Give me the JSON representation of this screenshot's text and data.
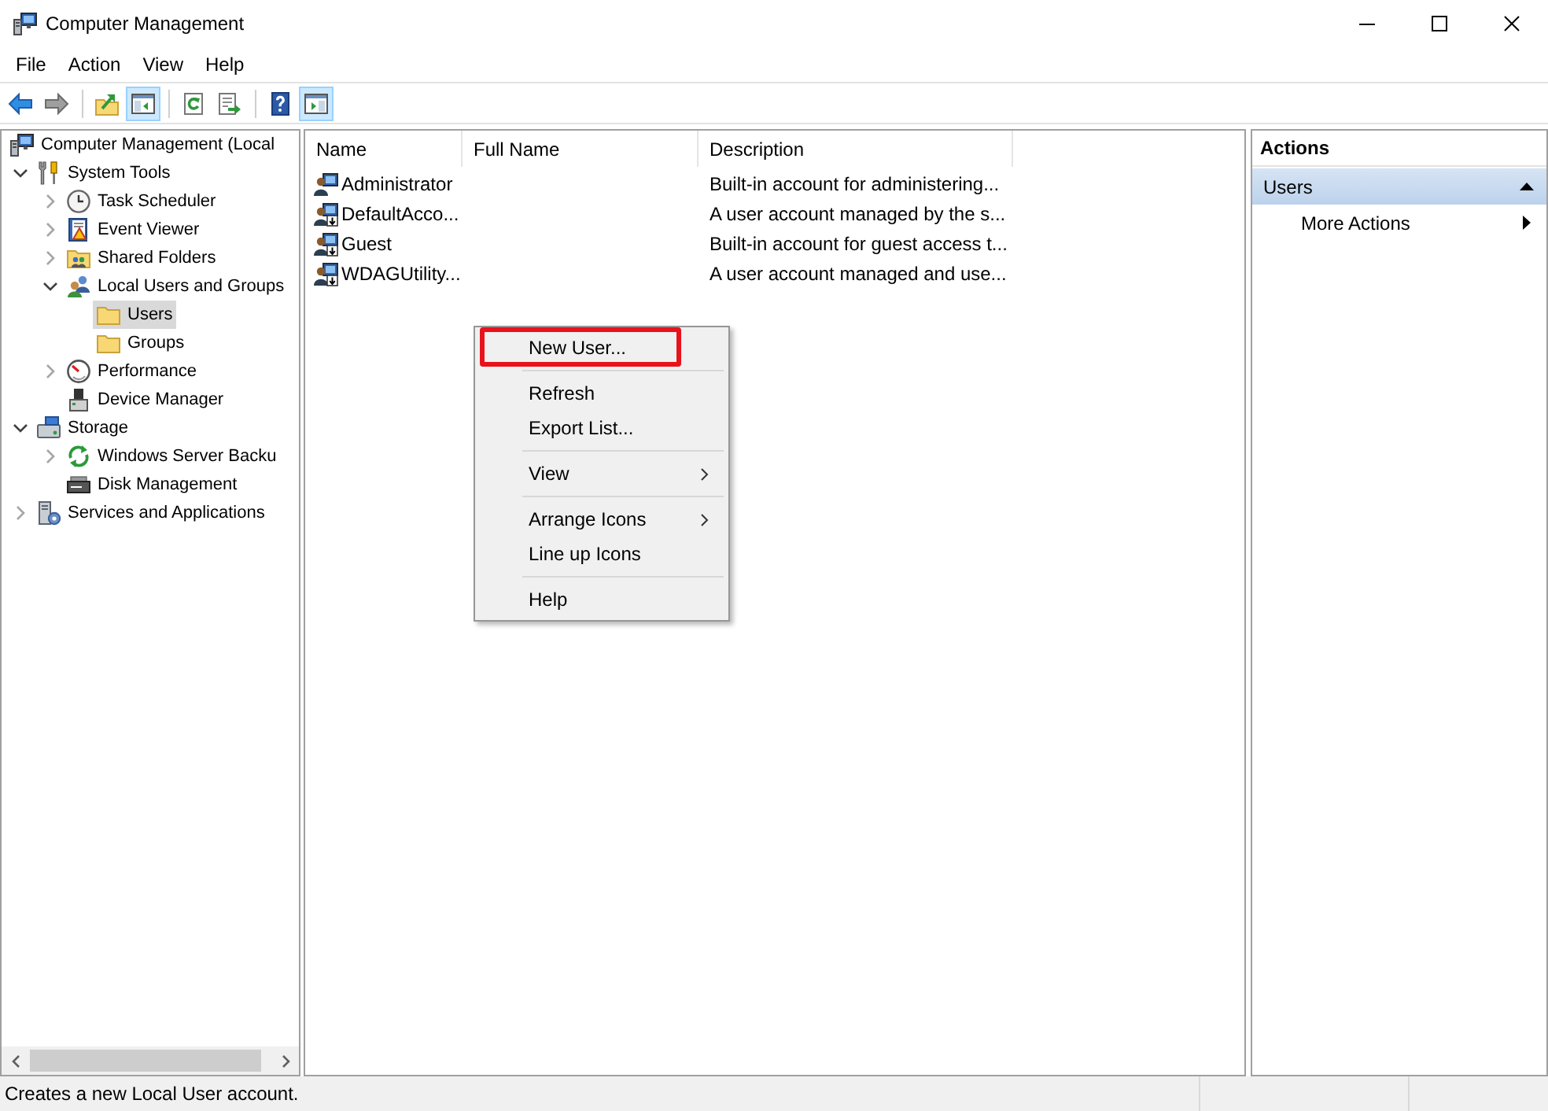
{
  "window": {
    "title": "Computer Management"
  },
  "menu_bar": [
    "File",
    "Action",
    "View",
    "Help"
  ],
  "toolbar": [
    {
      "buttons": [
        {
          "kind": "back",
          "on": false,
          "disabled": false
        },
        {
          "kind": "forward",
          "on": false,
          "disabled": true
        }
      ]
    },
    {
      "buttons": [
        {
          "kind": "up",
          "on": false,
          "disabled": false
        },
        {
          "kind": "console_tree",
          "on": true,
          "disabled": false
        }
      ]
    },
    {
      "buttons": [
        {
          "kind": "refresh",
          "on": false,
          "disabled": false
        },
        {
          "kind": "export",
          "on": false,
          "disabled": false
        }
      ]
    },
    {
      "buttons": [
        {
          "kind": "help",
          "on": false,
          "disabled": false
        },
        {
          "kind": "action_pane",
          "on": true,
          "disabled": false
        }
      ]
    }
  ],
  "tree": [
    {
      "label": "Computer Management (Local",
      "kind": "computer",
      "expandable": false,
      "selected": false,
      "children": [
        {
          "label": "System Tools",
          "kind": "tools",
          "expandable": true,
          "expanded": true,
          "selected": false,
          "children": [
            {
              "label": "Task Scheduler",
              "kind": "clock",
              "expandable": true,
              "expanded": false,
              "selected": false
            },
            {
              "label": "Event Viewer",
              "kind": "event_log",
              "expandable": true,
              "expanded": false,
              "selected": false
            },
            {
              "label": "Shared Folders",
              "kind": "shared_folders",
              "expandable": true,
              "expanded": false,
              "selected": false
            },
            {
              "label": "Local Users and Groups",
              "kind": "users_groups",
              "expandable": true,
              "expanded": true,
              "selected": false,
              "children": [
                {
                  "label": "Users",
                  "kind": "folder",
                  "expandable": false,
                  "selected": true
                },
                {
                  "label": "Groups",
                  "kind": "folder",
                  "expandable": false,
                  "selected": false
                }
              ]
            },
            {
              "label": "Performance",
              "kind": "performance",
              "expandable": true,
              "expanded": false,
              "selected": false
            },
            {
              "label": "Device Manager",
              "kind": "device_manager",
              "expandable": false,
              "selected": false
            }
          ]
        },
        {
          "label": "Storage",
          "kind": "storage",
          "expandable": true,
          "expanded": true,
          "selected": false,
          "children": [
            {
              "label": "Windows Server Backu",
              "kind": "backup",
              "expandable": true,
              "expanded": false,
              "selected": false
            },
            {
              "label": "Disk Management",
              "kind": "disk",
              "expandable": false,
              "selected": false
            }
          ]
        },
        {
          "label": "Services and Applications",
          "kind": "services",
          "expandable": true,
          "expanded": false,
          "selected": false
        }
      ]
    }
  ],
  "list": {
    "columns": [
      "Name",
      "Full Name",
      "Description"
    ],
    "rows": [
      {
        "name": "Administrator",
        "description": "Built-in account for administering...",
        "disabled": false
      },
      {
        "name": "DefaultAcco...",
        "description": "A user account managed by the s...",
        "disabled": true
      },
      {
        "name": "Guest",
        "description": "Built-in account for guest access t...",
        "disabled": true
      },
      {
        "name": "WDAGUtility...",
        "description": "A user account managed and use...",
        "disabled": true
      }
    ]
  },
  "context_menu": {
    "groups": [
      {
        "items": [
          {
            "label": "New User...",
            "submenu": false,
            "annotated": true
          }
        ]
      },
      {
        "items": [
          {
            "label": "Refresh",
            "submenu": false,
            "annotated": false
          },
          {
            "label": "Export List...",
            "submenu": false,
            "annotated": false
          }
        ]
      },
      {
        "items": [
          {
            "label": "View",
            "submenu": true,
            "annotated": false
          }
        ]
      },
      {
        "items": [
          {
            "label": "Arrange Icons",
            "submenu": true,
            "annotated": false
          },
          {
            "label": "Line up Icons",
            "submenu": false,
            "annotated": false
          }
        ]
      },
      {
        "items": [
          {
            "label": "Help",
            "submenu": false,
            "annotated": false
          }
        ]
      }
    ]
  },
  "actions_pane": {
    "title": "Actions",
    "sections": [
      {
        "label": "Users",
        "expanded": true,
        "items": [
          {
            "label": "More Actions",
            "submenu": true
          }
        ]
      }
    ]
  },
  "status_bar": {
    "text": "Creates a new Local User account."
  }
}
